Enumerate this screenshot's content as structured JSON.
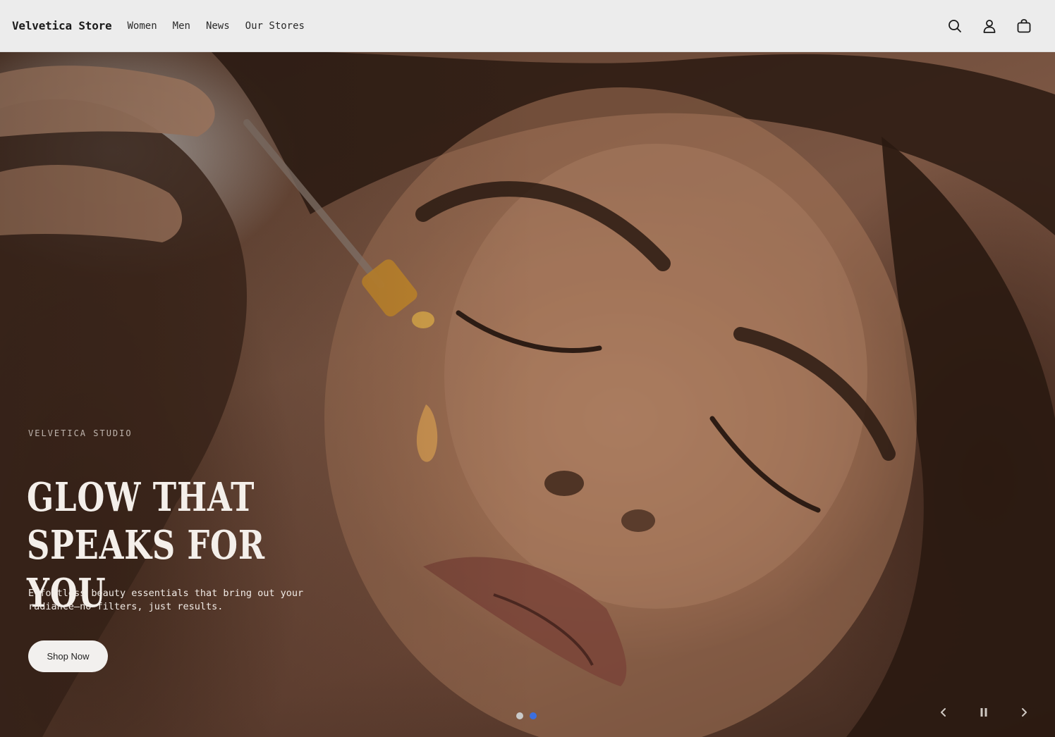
{
  "header": {
    "logo": "Velvetica Store",
    "nav": [
      {
        "label": "Women"
      },
      {
        "label": "Men"
      },
      {
        "label": "News"
      },
      {
        "label": "Our Stores"
      }
    ],
    "icons": [
      "search-icon",
      "account-icon",
      "bag-icon"
    ]
  },
  "hero": {
    "eyebrow": "VELVETICA STUDIO",
    "headline_line1": "GLOW THAT",
    "headline_line2": "SPEAKS FOR YOU",
    "subtext": "Effortless beauty essentials that bring out your radiance—no filters, just results.",
    "cta_label": "Shop Now",
    "slides": {
      "count": 2,
      "active_index": 1
    },
    "controls": [
      "previous-icon",
      "pause-icon",
      "next-icon"
    ]
  },
  "colors": {
    "header_bg": "#ececec",
    "dot_inactive": "#c9c9c9",
    "dot_active": "#3b6fe0",
    "button_bg": "#f2f0ee"
  }
}
